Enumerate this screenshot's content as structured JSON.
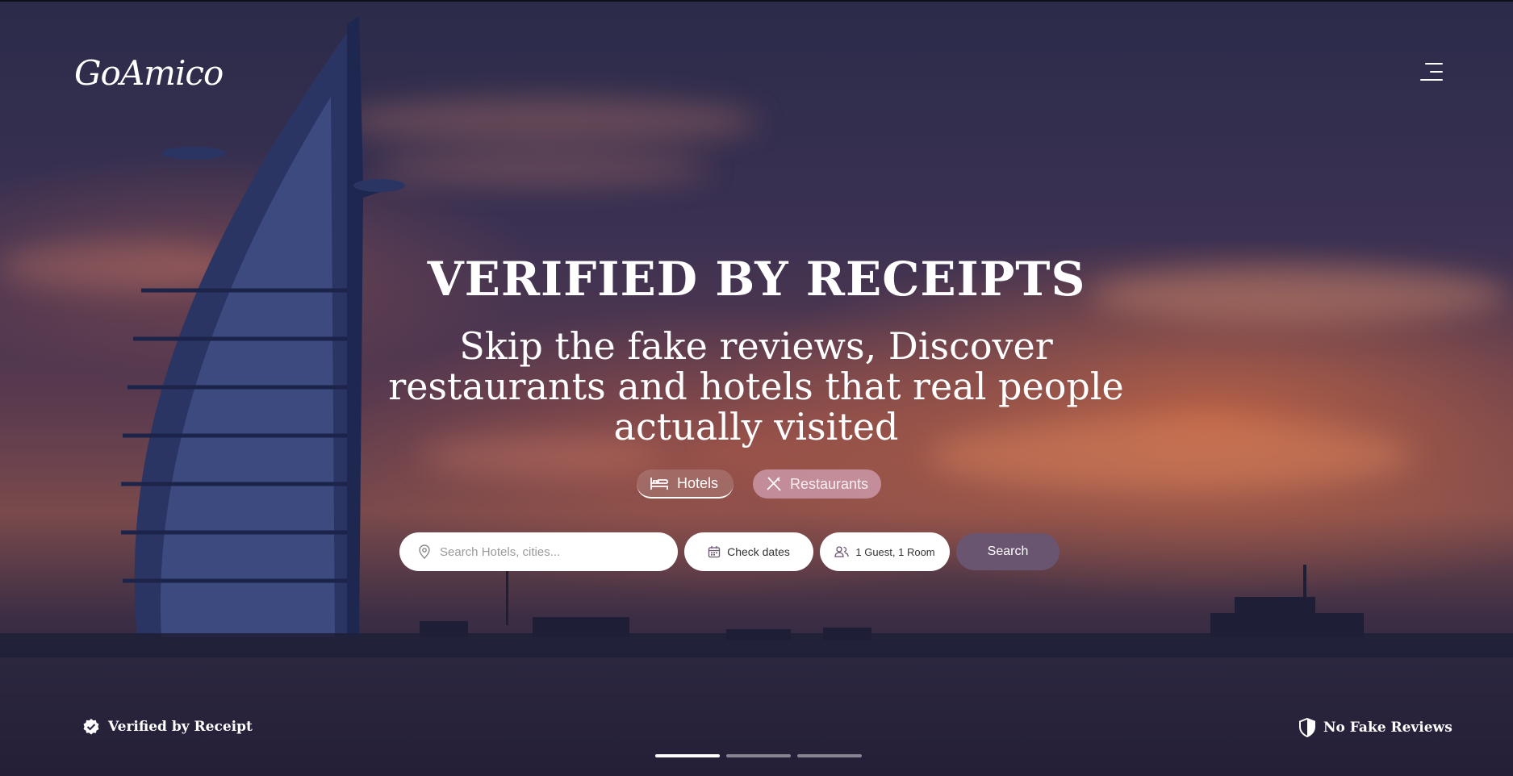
{
  "brand": {
    "logo_text": "GoAmico"
  },
  "header": {
    "menu_icon": "hamburger-menu-icon"
  },
  "hero": {
    "headline": "VERIFIED BY RECEIPTS",
    "subheadline": "Skip the fake reviews, Discover restaurants and hotels that real people actually visited"
  },
  "tabs": [
    {
      "label": "Hotels",
      "icon": "bed-icon",
      "active": true
    },
    {
      "label": "Restaurants",
      "icon": "utensils-icon",
      "active": false
    }
  ],
  "search": {
    "placeholder": "Search Hotels, cities...",
    "dates_label": "Check dates",
    "guests_label": "1 Guest, 1 Room",
    "submit_label": "Search"
  },
  "badges": {
    "left": {
      "label": "Verified by Receipt",
      "icon": "verified-check-icon"
    },
    "right": {
      "label": "No Fake Reviews",
      "icon": "shield-icon"
    }
  },
  "carousel": {
    "slides": 3,
    "active_index": 0
  },
  "colors": {
    "search_button": "#6a5570",
    "restaurants_tab": "#c79aae"
  }
}
